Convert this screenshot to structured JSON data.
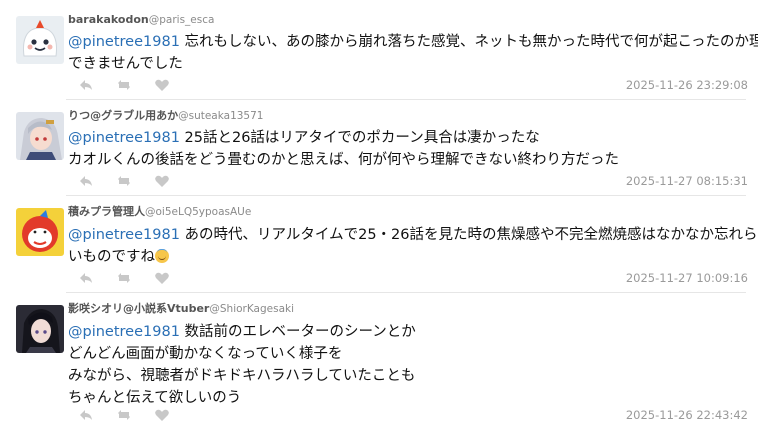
{
  "replies": [
    {
      "name": "barakakodon",
      "handle": "@paris_esca",
      "mention": "@pinetree1981",
      "lines": [
        "忘れもしない、あの膝から崩れ落ちた感覚、ネットも無かった時代で何が起こったのか理解",
        "できませんでした"
      ],
      "timestamp": "2025-11-26 23:29:08",
      "avatar_icon": "white-blob-face-avatar"
    },
    {
      "name": "りつ@グラブル用あか",
      "handle": "@suteaka13571",
      "mention": "@pinetree1981",
      "lines": [
        "25話と26話はリアタイでのポカーン具合は凄かったな",
        "カオルくんの後話をどう畳むのかと思えば、何が何やら理解できない終わり方だった"
      ],
      "timestamp": "2025-11-27 08:15:31",
      "avatar_icon": "anime-girl-silver-hair-avatar"
    },
    {
      "name": "積みプラ管理人",
      "handle": "@oi5eLQ5ypoasAUe",
      "mention": "@pinetree1981",
      "lines": [
        "あの時代、リアルタイムで25・26話を見た時の焦燥感や不完全燃焼感はなかなか忘れられな",
        "いものですね"
      ],
      "timestamp": "2025-11-27 10:09:16",
      "avatar_icon": "red-mascot-avatar"
    },
    {
      "name": "影咲シオリ@小説系Vtuber",
      "handle": "@ShiorKagesaki",
      "mention": "@pinetree1981",
      "lines": [
        "数話前のエレベーターのシーンとか",
        "どんどん画面が動かなくなっていく様子を",
        "みながら、視聴者がドキドキハラハラしていたことも",
        "ちゃんと伝えて欲しいのう"
      ],
      "timestamp": "2025-11-26 22:43:42",
      "avatar_icon": "dark-hair-girl-avatar"
    }
  ],
  "actions": {
    "reply_icon": "reply-icon",
    "retweet_icon": "retweet-icon",
    "like_icon": "heart-icon"
  },
  "colors": {
    "mention": "#2a6fb5",
    "timestamp": "#9a9a9a",
    "icon": "#c8c8c8"
  }
}
